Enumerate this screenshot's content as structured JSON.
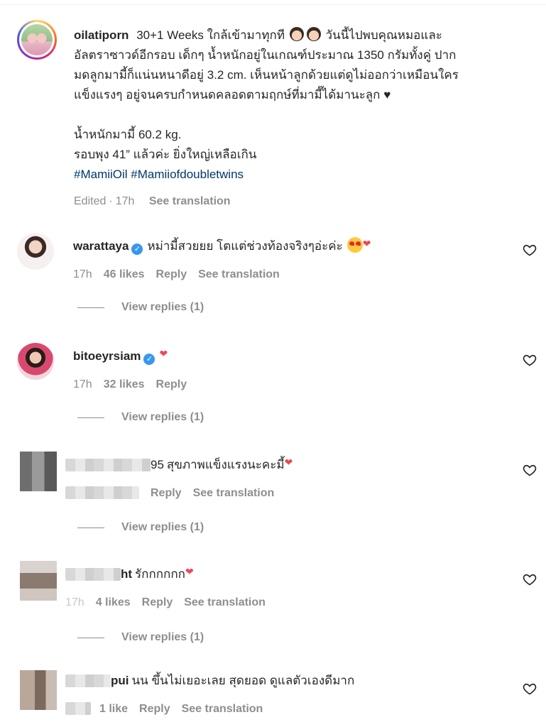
{
  "caption": {
    "username": "oilatiporn",
    "text_line1": "30+1 Weeks ใกล้เข้ามาทุกที",
    "text_line1b": "วันนี้ไปพบคุณหมอและ",
    "text_line2": "อัลตราซาวด์อีกรอบ เด็กๆ น้ำหนักอยู่ในเกณฑ์ประมาณ 1350 กรัมทั้งคู่ ปาก",
    "text_line3": "มดลูกมามี้ก็แน่นหนาดีอยู่ 3.2 cm. เห็นหน้าลูกด้วยแต่ดูไม่ออกว่าเหมือนใคร",
    "text_line4": "แข็งแรงๆ อยู่จนครบกำหนดคลอดตามฤกษ์ที่มามี๊ได้มานะลูก",
    "heart": "♥",
    "weight": "น้ำหนักมามี้ 60.2 kg.",
    "belly": "รอบพุง 41” แล้วค่ะ ยิ่งใหญ่เหลือเกิน",
    "hashtag1": "#MamiiOil",
    "hashtag2": "#Mamiiofdoubletwins",
    "edited": "Edited",
    "dot": "·",
    "time": "17h",
    "see_translation": "See translation"
  },
  "comments": [
    {
      "username": "warattaya",
      "verified": true,
      "text": "หม่ามี้สวยยย โตแต่ช่วงท้องจริงๆอ่ะค่ะ",
      "time": "17h",
      "likes": "46 likes",
      "reply": "Reply",
      "see_translation": "See translation",
      "view_replies": "View replies (1)"
    },
    {
      "username": "bitoeyrsiam",
      "verified": true,
      "text": "",
      "time": "17h",
      "likes": "32 likes",
      "reply": "Reply",
      "see_translation": "",
      "view_replies": "View replies (1)"
    },
    {
      "username": "95",
      "text": "สุขภาพแข็งแรงนะคะมี้",
      "time": "",
      "likes": "",
      "reply": "Reply",
      "see_translation": "See translation",
      "view_replies": "View replies (1)"
    },
    {
      "username": "ht",
      "text": "รักกกกกก",
      "time": "17h",
      "likes": "4 likes",
      "reply": "Reply",
      "see_translation": "See translation",
      "view_replies": "View replies (1)"
    },
    {
      "username": "pui",
      "text": "นน ขึ้นไม่เยอะเลย สุดยอด ดูแลตัวเองดีมาก",
      "time": "",
      "likes": "1 like",
      "reply": "Reply",
      "see_translation": "See translation"
    }
  ],
  "icons": {
    "like": "heart-outline-icon",
    "verified": "verified-badge-icon"
  },
  "colors": {
    "text": "#262626",
    "muted": "#8e8e8e",
    "hashtag": "#00376b",
    "verified": "#3897f0",
    "heart": "#ed4956"
  }
}
